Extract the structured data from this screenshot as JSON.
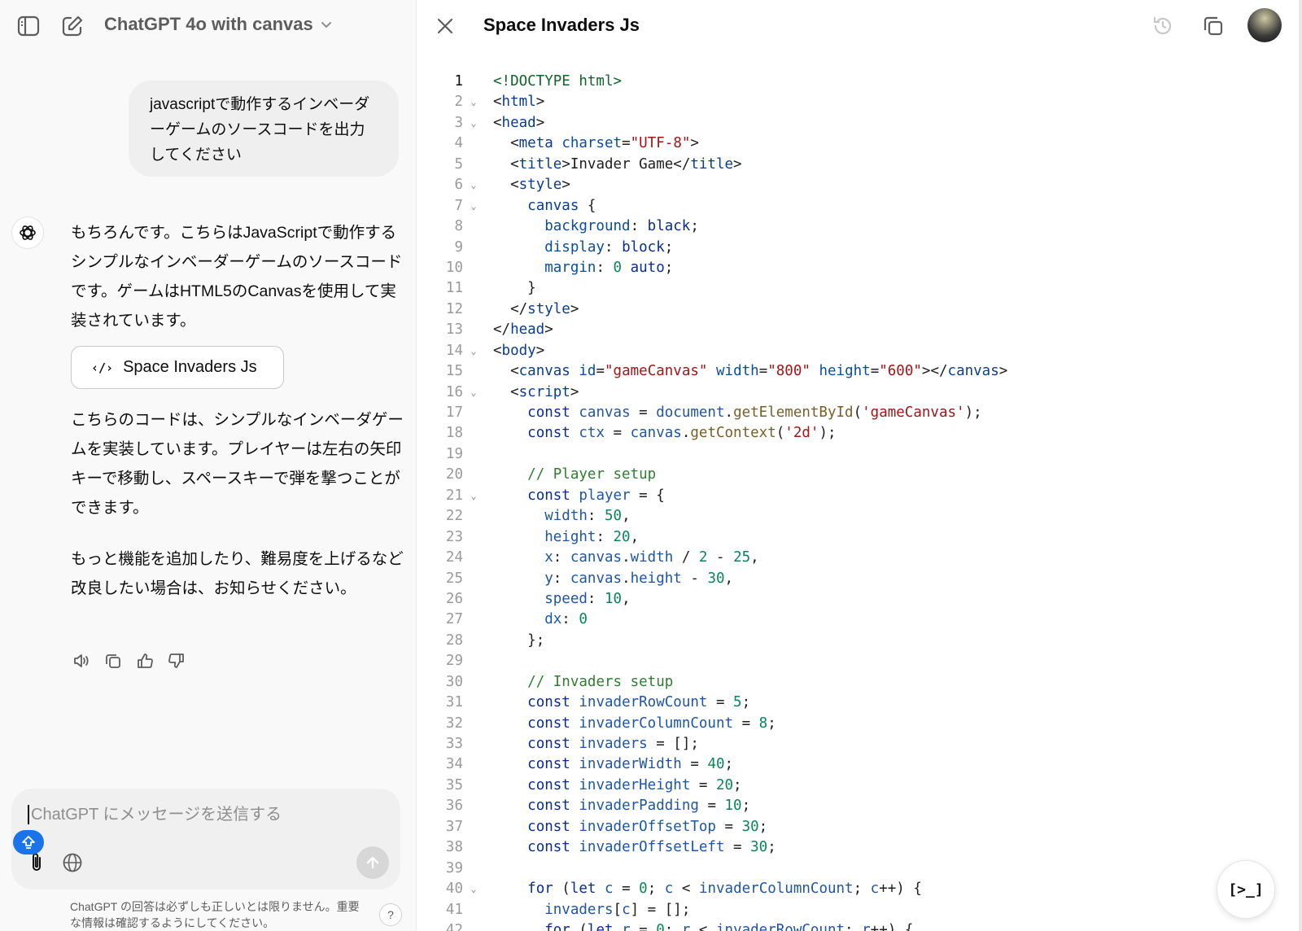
{
  "app": {
    "model_name": "ChatGPT 4o with canvas"
  },
  "chat": {
    "user_message": "javascriptで動作するインベーダーゲームのソースコードを出力してください",
    "assistant": {
      "paragraph_1": "もちろんです。こちらはJavaScriptで動作するシンプルなインベーダーゲームのソースコードです。ゲームはHTML5のCanvasを使用して実装されています。",
      "canvas_chip_label": "Space Invaders Js",
      "paragraph_2": "こちらのコードは、シンプルなインベーダゲームを実装しています。プレイヤーは左右の矢印キーで移動し、スペースキーで弾を撃つことができます。",
      "paragraph_3": "もっと機能を追加したり、難易度を上げるなど改良したい場合は、お知らせください。"
    },
    "composer_placeholder": "ChatGPT にメッセージを送信する",
    "disclaimer": "ChatGPT の回答は必ずしも正しいとは限りません。重要な情報は確認するようにしてください。",
    "help_label": "?"
  },
  "canvas": {
    "title": "Space Invaders Js",
    "fab_label": "[>_]",
    "active_line": 1,
    "lines": [
      {
        "n": "1",
        "fold": false,
        "indent": 0,
        "tokens": [
          [
            "tag",
            "<!DOCTYPE html>"
          ]
        ]
      },
      {
        "n": "2",
        "fold": true,
        "indent": 0,
        "tokens": [
          [
            "p",
            "<"
          ],
          [
            "name",
            "html"
          ],
          [
            "p",
            ">"
          ]
        ]
      },
      {
        "n": "3",
        "fold": true,
        "indent": 0,
        "tokens": [
          [
            "p",
            "<"
          ],
          [
            "name",
            "head"
          ],
          [
            "p",
            ">"
          ]
        ]
      },
      {
        "n": "4",
        "fold": false,
        "indent": 1,
        "tokens": [
          [
            "p",
            "<"
          ],
          [
            "name",
            "meta"
          ],
          [
            "p",
            " "
          ],
          [
            "attr",
            "charset"
          ],
          [
            "p",
            "="
          ],
          [
            "str",
            "\"UTF-8\""
          ],
          [
            "p",
            ">"
          ]
        ]
      },
      {
        "n": "5",
        "fold": false,
        "indent": 1,
        "tokens": [
          [
            "p",
            "<"
          ],
          [
            "name",
            "title"
          ],
          [
            "p",
            ">Invader Game</"
          ],
          [
            "name",
            "title"
          ],
          [
            "p",
            ">"
          ]
        ]
      },
      {
        "n": "6",
        "fold": true,
        "indent": 1,
        "tokens": [
          [
            "p",
            "<"
          ],
          [
            "name",
            "style"
          ],
          [
            "p",
            ">"
          ]
        ]
      },
      {
        "n": "7",
        "fold": true,
        "indent": 2,
        "tokens": [
          [
            "name",
            "canvas"
          ],
          [
            "p",
            " {"
          ]
        ]
      },
      {
        "n": "8",
        "fold": false,
        "indent": 3,
        "tokens": [
          [
            "attr",
            "background"
          ],
          [
            "p",
            ": "
          ],
          [
            "kw",
            "black"
          ],
          [
            "p",
            ";"
          ]
        ]
      },
      {
        "n": "9",
        "fold": false,
        "indent": 3,
        "tokens": [
          [
            "attr",
            "display"
          ],
          [
            "p",
            ": "
          ],
          [
            "kw",
            "block"
          ],
          [
            "p",
            ";"
          ]
        ]
      },
      {
        "n": "10",
        "fold": false,
        "indent": 3,
        "tokens": [
          [
            "attr",
            "margin"
          ],
          [
            "p",
            ": "
          ],
          [
            "num",
            "0"
          ],
          [
            "p",
            " "
          ],
          [
            "kw",
            "auto"
          ],
          [
            "p",
            ";"
          ]
        ]
      },
      {
        "n": "11",
        "fold": false,
        "indent": 2,
        "tokens": [
          [
            "p",
            "}"
          ]
        ]
      },
      {
        "n": "12",
        "fold": false,
        "indent": 1,
        "tokens": [
          [
            "p",
            "</"
          ],
          [
            "name",
            "style"
          ],
          [
            "p",
            ">"
          ]
        ]
      },
      {
        "n": "13",
        "fold": false,
        "indent": 0,
        "tokens": [
          [
            "p",
            "</"
          ],
          [
            "name",
            "head"
          ],
          [
            "p",
            ">"
          ]
        ]
      },
      {
        "n": "14",
        "fold": true,
        "indent": 0,
        "tokens": [
          [
            "p",
            "<"
          ],
          [
            "name",
            "body"
          ],
          [
            "p",
            ">"
          ]
        ]
      },
      {
        "n": "15",
        "fold": false,
        "indent": 1,
        "tokens": [
          [
            "p",
            "<"
          ],
          [
            "name",
            "canvas"
          ],
          [
            "p",
            " "
          ],
          [
            "attr",
            "id"
          ],
          [
            "p",
            "="
          ],
          [
            "str",
            "\"gameCanvas\""
          ],
          [
            "p",
            " "
          ],
          [
            "attr",
            "width"
          ],
          [
            "p",
            "="
          ],
          [
            "str",
            "\"800\""
          ],
          [
            "p",
            " "
          ],
          [
            "attr",
            "height"
          ],
          [
            "p",
            "="
          ],
          [
            "str",
            "\"600\""
          ],
          [
            "p",
            "></"
          ],
          [
            "name",
            "canvas"
          ],
          [
            "p",
            ">"
          ]
        ]
      },
      {
        "n": "16",
        "fold": true,
        "indent": 1,
        "tokens": [
          [
            "p",
            "<"
          ],
          [
            "name",
            "script"
          ],
          [
            "p",
            ">"
          ]
        ]
      },
      {
        "n": "17",
        "fold": false,
        "indent": 2,
        "tokens": [
          [
            "kw",
            "const"
          ],
          [
            "p",
            " "
          ],
          [
            "var",
            "canvas"
          ],
          [
            "p",
            " = "
          ],
          [
            "var",
            "document"
          ],
          [
            "p",
            "."
          ],
          [
            "fn",
            "getElementById"
          ],
          [
            "p",
            "("
          ],
          [
            "str",
            "'gameCanvas'"
          ],
          [
            "p",
            ");"
          ]
        ]
      },
      {
        "n": "18",
        "fold": false,
        "indent": 2,
        "tokens": [
          [
            "kw",
            "const"
          ],
          [
            "p",
            " "
          ],
          [
            "var",
            "ctx"
          ],
          [
            "p",
            " = "
          ],
          [
            "var",
            "canvas"
          ],
          [
            "p",
            "."
          ],
          [
            "fn",
            "getContext"
          ],
          [
            "p",
            "("
          ],
          [
            "str",
            "'2d'"
          ],
          [
            "p",
            ");"
          ]
        ]
      },
      {
        "n": "19",
        "fold": false,
        "indent": 0,
        "tokens": []
      },
      {
        "n": "20",
        "fold": false,
        "indent": 2,
        "tokens": [
          [
            "cmt",
            "// Player setup"
          ]
        ]
      },
      {
        "n": "21",
        "fold": true,
        "indent": 2,
        "tokens": [
          [
            "kw",
            "const"
          ],
          [
            "p",
            " "
          ],
          [
            "var",
            "player"
          ],
          [
            "p",
            " = {"
          ]
        ]
      },
      {
        "n": "22",
        "fold": false,
        "indent": 3,
        "tokens": [
          [
            "var",
            "width"
          ],
          [
            "p",
            ": "
          ],
          [
            "num",
            "50"
          ],
          [
            "p",
            ","
          ]
        ]
      },
      {
        "n": "23",
        "fold": false,
        "indent": 3,
        "tokens": [
          [
            "var",
            "height"
          ],
          [
            "p",
            ": "
          ],
          [
            "num",
            "20"
          ],
          [
            "p",
            ","
          ]
        ]
      },
      {
        "n": "24",
        "fold": false,
        "indent": 3,
        "tokens": [
          [
            "var",
            "x"
          ],
          [
            "p",
            ": "
          ],
          [
            "var",
            "canvas"
          ],
          [
            "p",
            "."
          ],
          [
            "var",
            "width"
          ],
          [
            "p",
            " / "
          ],
          [
            "num",
            "2"
          ],
          [
            "p",
            " - "
          ],
          [
            "num",
            "25"
          ],
          [
            "p",
            ","
          ]
        ]
      },
      {
        "n": "25",
        "fold": false,
        "indent": 3,
        "tokens": [
          [
            "var",
            "y"
          ],
          [
            "p",
            ": "
          ],
          [
            "var",
            "canvas"
          ],
          [
            "p",
            "."
          ],
          [
            "var",
            "height"
          ],
          [
            "p",
            " - "
          ],
          [
            "num",
            "30"
          ],
          [
            "p",
            ","
          ]
        ]
      },
      {
        "n": "26",
        "fold": false,
        "indent": 3,
        "tokens": [
          [
            "var",
            "speed"
          ],
          [
            "p",
            ": "
          ],
          [
            "num",
            "10"
          ],
          [
            "p",
            ","
          ]
        ]
      },
      {
        "n": "27",
        "fold": false,
        "indent": 3,
        "tokens": [
          [
            "var",
            "dx"
          ],
          [
            "p",
            ": "
          ],
          [
            "num",
            "0"
          ]
        ]
      },
      {
        "n": "28",
        "fold": false,
        "indent": 2,
        "tokens": [
          [
            "p",
            "};"
          ]
        ]
      },
      {
        "n": "29",
        "fold": false,
        "indent": 0,
        "tokens": []
      },
      {
        "n": "30",
        "fold": false,
        "indent": 2,
        "tokens": [
          [
            "cmt",
            "// Invaders setup"
          ]
        ]
      },
      {
        "n": "31",
        "fold": false,
        "indent": 2,
        "tokens": [
          [
            "kw",
            "const"
          ],
          [
            "p",
            " "
          ],
          [
            "var",
            "invaderRowCount"
          ],
          [
            "p",
            " = "
          ],
          [
            "num",
            "5"
          ],
          [
            "p",
            ";"
          ]
        ]
      },
      {
        "n": "32",
        "fold": false,
        "indent": 2,
        "tokens": [
          [
            "kw",
            "const"
          ],
          [
            "p",
            " "
          ],
          [
            "var",
            "invaderColumnCount"
          ],
          [
            "p",
            " = "
          ],
          [
            "num",
            "8"
          ],
          [
            "p",
            ";"
          ]
        ]
      },
      {
        "n": "33",
        "fold": false,
        "indent": 2,
        "tokens": [
          [
            "kw",
            "const"
          ],
          [
            "p",
            " "
          ],
          [
            "var",
            "invaders"
          ],
          [
            "p",
            " = [];"
          ]
        ]
      },
      {
        "n": "34",
        "fold": false,
        "indent": 2,
        "tokens": [
          [
            "kw",
            "const"
          ],
          [
            "p",
            " "
          ],
          [
            "var",
            "invaderWidth"
          ],
          [
            "p",
            " = "
          ],
          [
            "num",
            "40"
          ],
          [
            "p",
            ";"
          ]
        ]
      },
      {
        "n": "35",
        "fold": false,
        "indent": 2,
        "tokens": [
          [
            "kw",
            "const"
          ],
          [
            "p",
            " "
          ],
          [
            "var",
            "invaderHeight"
          ],
          [
            "p",
            " = "
          ],
          [
            "num",
            "20"
          ],
          [
            "p",
            ";"
          ]
        ]
      },
      {
        "n": "36",
        "fold": false,
        "indent": 2,
        "tokens": [
          [
            "kw",
            "const"
          ],
          [
            "p",
            " "
          ],
          [
            "var",
            "invaderPadding"
          ],
          [
            "p",
            " = "
          ],
          [
            "num",
            "10"
          ],
          [
            "p",
            ";"
          ]
        ]
      },
      {
        "n": "37",
        "fold": false,
        "indent": 2,
        "tokens": [
          [
            "kw",
            "const"
          ],
          [
            "p",
            " "
          ],
          [
            "var",
            "invaderOffsetTop"
          ],
          [
            "p",
            " = "
          ],
          [
            "num",
            "30"
          ],
          [
            "p",
            ";"
          ]
        ]
      },
      {
        "n": "38",
        "fold": false,
        "indent": 2,
        "tokens": [
          [
            "kw",
            "const"
          ],
          [
            "p",
            " "
          ],
          [
            "var",
            "invaderOffsetLeft"
          ],
          [
            "p",
            " = "
          ],
          [
            "num",
            "30"
          ],
          [
            "p",
            ";"
          ]
        ]
      },
      {
        "n": "39",
        "fold": false,
        "indent": 0,
        "tokens": []
      },
      {
        "n": "40",
        "fold": true,
        "indent": 2,
        "tokens": [
          [
            "kw",
            "for"
          ],
          [
            "p",
            " ("
          ],
          [
            "kw",
            "let"
          ],
          [
            "p",
            " "
          ],
          [
            "var",
            "c"
          ],
          [
            "p",
            " = "
          ],
          [
            "num",
            "0"
          ],
          [
            "p",
            "; "
          ],
          [
            "var",
            "c"
          ],
          [
            "p",
            " < "
          ],
          [
            "var",
            "invaderColumnCount"
          ],
          [
            "p",
            "; "
          ],
          [
            "var",
            "c"
          ],
          [
            "p",
            "++) {"
          ]
        ]
      },
      {
        "n": "41",
        "fold": false,
        "indent": 3,
        "tokens": [
          [
            "var",
            "invaders"
          ],
          [
            "p",
            "["
          ],
          [
            "var",
            "c"
          ],
          [
            "p",
            "] = [];"
          ]
        ]
      },
      {
        "n": "42",
        "fold": true,
        "indent": 3,
        "tokens": [
          [
            "kw",
            "for"
          ],
          [
            "p",
            " ("
          ],
          [
            "kw",
            "let"
          ],
          [
            "p",
            " "
          ],
          [
            "var",
            "r"
          ],
          [
            "p",
            " = "
          ],
          [
            "num",
            "0"
          ],
          [
            "p",
            "; "
          ],
          [
            "var",
            "r"
          ],
          [
            "p",
            " < "
          ],
          [
            "var",
            "invaderRowCount"
          ],
          [
            "p",
            "; "
          ],
          [
            "var",
            "r"
          ],
          [
            "p",
            "++) {"
          ]
        ]
      }
    ]
  }
}
